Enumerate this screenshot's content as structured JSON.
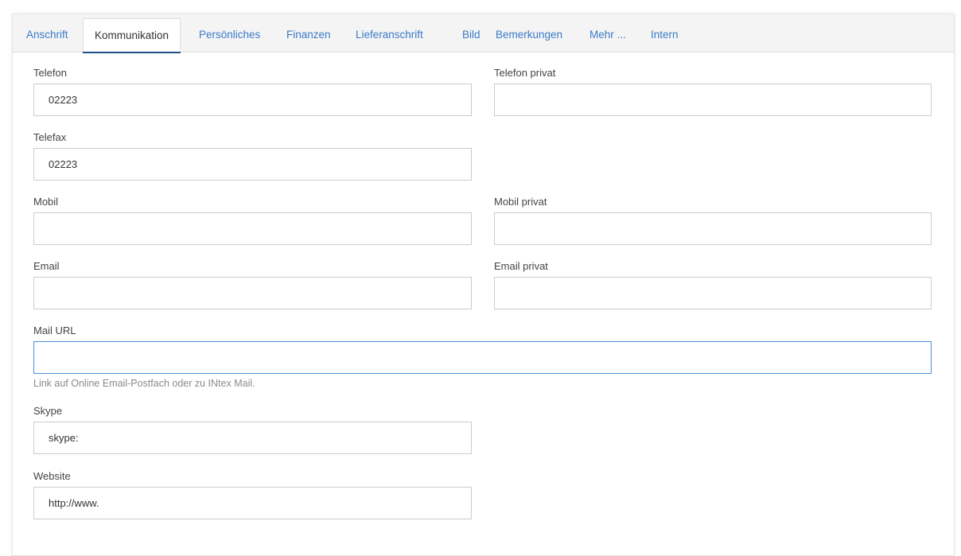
{
  "tabs": [
    {
      "label": "Anschrift",
      "active": false
    },
    {
      "label": "Kommunikation",
      "active": true
    },
    {
      "label": "Persönliches",
      "active": false
    },
    {
      "label": "Finanzen",
      "active": false
    },
    {
      "label": "Lieferanschrift",
      "active": false
    },
    {
      "label": "Bild",
      "active": false
    },
    {
      "label": "Bemerkungen",
      "active": false
    },
    {
      "label": "Mehr ...",
      "active": false
    },
    {
      "label": "Intern",
      "active": false
    }
  ],
  "form": {
    "telefon": {
      "label": "Telefon",
      "value": "02223"
    },
    "telefon_privat": {
      "label": "Telefon privat",
      "value": ""
    },
    "telefax": {
      "label": "Telefax",
      "value": "02223"
    },
    "mobil": {
      "label": "Mobil",
      "value": ""
    },
    "mobil_privat": {
      "label": "Mobil privat",
      "value": ""
    },
    "email": {
      "label": "Email",
      "value": ""
    },
    "email_privat": {
      "label": "Email privat",
      "value": ""
    },
    "mail_url": {
      "label": "Mail URL",
      "value": "",
      "hint": "Link auf Online Email-Postfach oder zu INtex Mail."
    },
    "skype": {
      "label": "Skype",
      "value": "skype:"
    },
    "website": {
      "label": "Website",
      "value": "http://www."
    }
  },
  "colors": {
    "tab_link": "#3a7bc8",
    "active_underline": "#1d4f8a",
    "focus_border": "#4a90d9"
  }
}
